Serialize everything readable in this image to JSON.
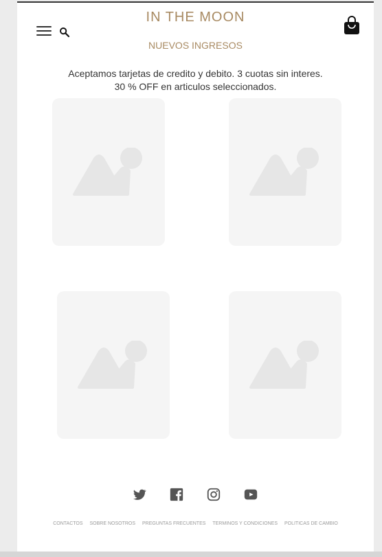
{
  "header": {
    "brand": "IN THE MOON",
    "menu_icon": "hamburger-menu-icon",
    "search_icon": "search-icon",
    "cart_icon": "shopping-bag-icon"
  },
  "nav": {
    "new_arrivals": "NUEVOS INGRESOS"
  },
  "promo": {
    "line1": "Aceptamos tarjetas de credito y debito. 3 cuotas sin interes.",
    "line2": "30 % OFF en articulos seleccionados."
  },
  "products": [
    {
      "image_icon": "image-placeholder-icon"
    },
    {
      "image_icon": "image-placeholder-icon"
    },
    {
      "image_icon": "image-placeholder-icon"
    },
    {
      "image_icon": "image-placeholder-icon"
    }
  ],
  "social": [
    "twitter-icon",
    "facebook-icon",
    "instagram-icon",
    "youtube-icon"
  ],
  "footer": {
    "links": [
      "CONTACTOS",
      "SOBRE NOSOTROS",
      "PREGUNTAS FRECUENTES",
      "TERMINOS Y CONDICIONES",
      "POLITICAS DE CAMBIO"
    ]
  },
  "colors": {
    "brand": "#a88a62",
    "placeholder": "#f5f5f5",
    "placeholder_icon": "#e6e6e6"
  }
}
